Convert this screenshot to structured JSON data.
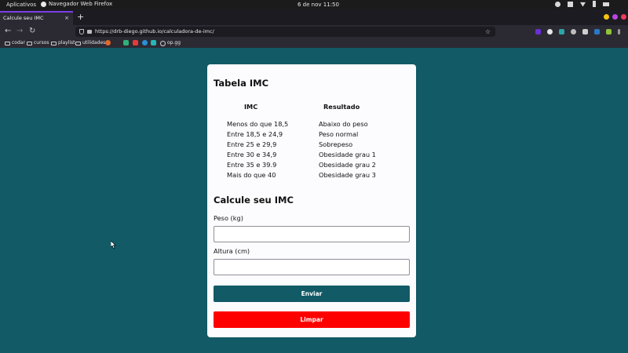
{
  "os_bar": {
    "apps_label": "Aplicativos",
    "browser_label": "Navegador Web Firefox",
    "datetime": "6 de nov  11:50"
  },
  "tab": {
    "title": "Calcule seu IMC",
    "close": "×",
    "new_tab": "+"
  },
  "nav": {
    "back": "←",
    "forward": "→",
    "reload": "↻"
  },
  "address_bar": {
    "url": "https://drb-diego.github.io/calculadora-de-imc/",
    "star": "☆"
  },
  "bookmarks": [
    {
      "label": "codar"
    },
    {
      "label": "cursos"
    },
    {
      "label": "playlist"
    },
    {
      "label": "utilidades"
    },
    {
      "label": "op.gg"
    }
  ],
  "page": {
    "table_title": "Tabela IMC",
    "table_headers": [
      "IMC",
      "Resultado"
    ],
    "table_rows": [
      [
        "Menos do que 18,5",
        "Abaixo do peso"
      ],
      [
        "Entre 18,5 e 24,9",
        "Peso normal"
      ],
      [
        "Entre 25 e 29,9",
        "Sobrepeso"
      ],
      [
        "Entre 30 e 34,9",
        "Obesidade grau 1"
      ],
      [
        "Entre 35 e 39.9",
        "Obesidade grau 2"
      ],
      [
        "Mais do que 40",
        "Obesidade grau 3"
      ]
    ],
    "form_title": "Calcule seu IMC",
    "weight_label": "Peso (kg)",
    "weight_value": "",
    "height_label": "Altura (cm)",
    "height_value": "",
    "submit_label": "Enviar",
    "clear_label": "Limpar"
  },
  "colors": {
    "background": "#115a66",
    "submit_button": "#115a66",
    "clear_button": "#ff0000",
    "tab_accent": "#7b3fe4"
  }
}
